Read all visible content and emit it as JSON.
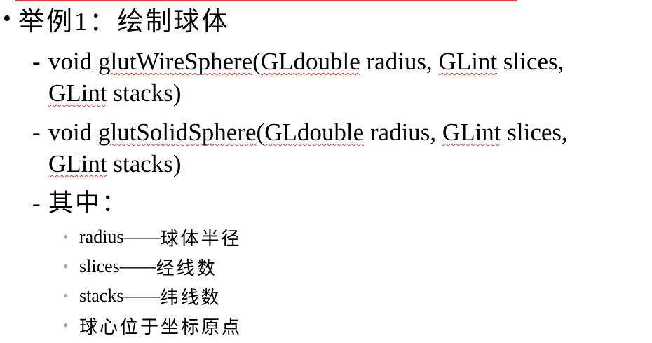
{
  "heading": {
    "bullet": "•",
    "text": "举例1：绘制球体"
  },
  "items": [
    {
      "dash": "-",
      "prefix": "void ",
      "func": "glutWireSphere",
      "paren": "(",
      "t1": "GLdouble",
      "a1": " radius, ",
      "t2": "GLint",
      "a2": " slices,",
      "t3": "GLint",
      "a3": " stacks)"
    },
    {
      "dash": "-",
      "prefix": "void ",
      "func": "glutSolidSphere",
      "paren": "(",
      "t1": "GLdouble",
      "a1": " radius, ",
      "t2": "GLint",
      "a2": " slices,",
      "t3": "GLint",
      "a3": " stacks)"
    }
  ],
  "where": {
    "dash": "-",
    "label": "其中："
  },
  "details": [
    {
      "bullet": "•",
      "term": "radius",
      "sep": "——",
      "desc": "球体半径"
    },
    {
      "bullet": "•",
      "term": "slices",
      "sep": "——",
      "desc": "经线数"
    },
    {
      "bullet": "•",
      "term": "stacks",
      "sep": "——",
      "desc": "纬线数"
    },
    {
      "bullet": "•",
      "term": "",
      "sep": "",
      "desc": "球心位于坐标原点"
    }
  ]
}
